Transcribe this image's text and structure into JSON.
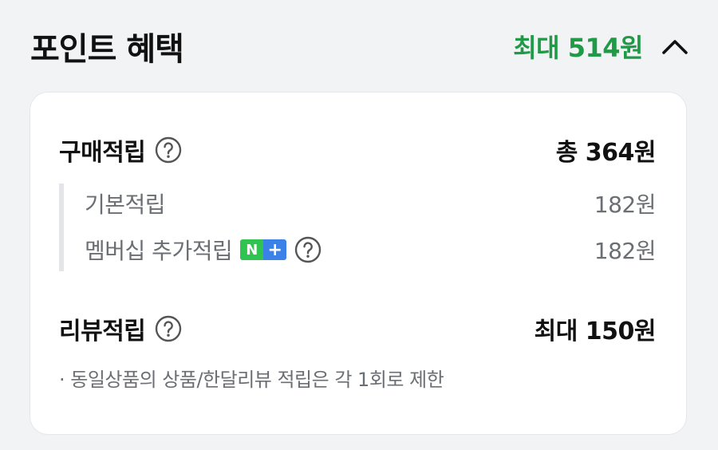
{
  "header": {
    "title": "포인트 혜택",
    "max_amount": "최대 514원"
  },
  "purchase": {
    "label": "구매적립",
    "total": "총 364원",
    "items": [
      {
        "label": "기본적립",
        "amount": "182원"
      },
      {
        "label": "멤버십 추가적립",
        "amount": "182원",
        "badge": [
          "N",
          "+"
        ]
      }
    ]
  },
  "review": {
    "label": "리뷰적립",
    "amount": "최대 150원",
    "note": "· 동일상품의 상품/한달리뷰 적립은 각 1회로 제한"
  },
  "colors": {
    "accent": "#1f9a47",
    "badge_green": "#2fc34f",
    "badge_blue": "#3b82e8"
  },
  "icons": [
    "chevron-up-icon",
    "question-circle-icon"
  ]
}
